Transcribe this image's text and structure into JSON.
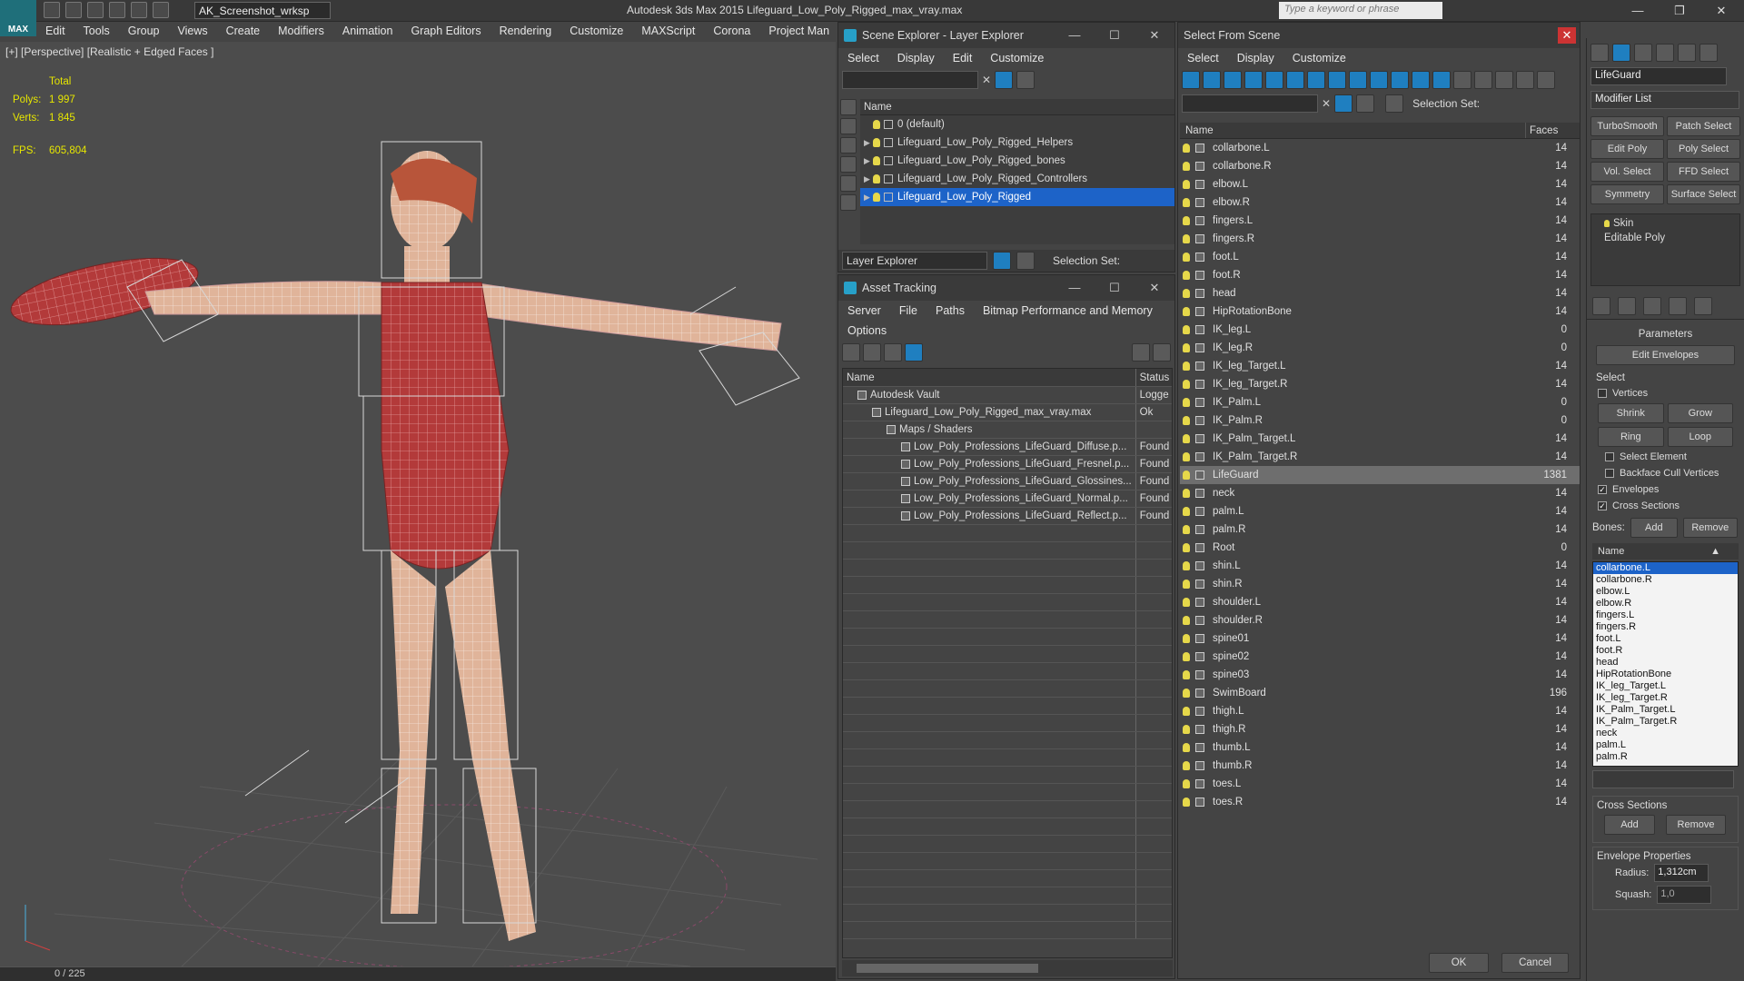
{
  "app": {
    "title": "Autodesk 3ds Max  2015     Lifeguard_Low_Poly_Rigged_max_vray.max",
    "logo": "MAX",
    "workspace": "AK_Screenshot_wrksp",
    "search_placeholder": "Type a keyword or phrase",
    "menu": [
      "Edit",
      "Tools",
      "Group",
      "Views",
      "Create",
      "Modifiers",
      "Animation",
      "Graph Editors",
      "Rendering",
      "Customize",
      "MAXScript",
      "Corona",
      "Project Man"
    ],
    "window_buttons": [
      "—",
      "❐",
      "✕"
    ]
  },
  "viewport": {
    "label": "[+] [Perspective] [Realistic + Edged Faces ]",
    "stats": {
      "total_label": "Total",
      "polys_label": "Polys:",
      "polys": "1 997",
      "verts_label": "Verts:",
      "verts": "1 845",
      "fps_label": "FPS:",
      "fps": "605,804"
    },
    "timeline": "0 / 225"
  },
  "scene_explorer": {
    "title": "Scene Explorer - Layer Explorer",
    "menu": [
      "Select",
      "Display",
      "Edit",
      "Customize"
    ],
    "column": "Name",
    "layers": [
      {
        "name": "0 (default)",
        "expandable": false,
        "selected": false
      },
      {
        "name": "Lifeguard_Low_Poly_Rigged_Helpers",
        "expandable": true,
        "selected": false
      },
      {
        "name": "Lifeguard_Low_Poly_Rigged_bones",
        "expandable": true,
        "selected": false
      },
      {
        "name": "Lifeguard_Low_Poly_Rigged_Controllers",
        "expandable": true,
        "selected": false
      },
      {
        "name": "Lifeguard_Low_Poly_Rigged",
        "expandable": true,
        "selected": true
      }
    ],
    "footer_label": "Layer Explorer",
    "selection_set": "Selection Set:"
  },
  "asset_tracking": {
    "title": "Asset Tracking",
    "menu": [
      "Server",
      "File",
      "Paths",
      "Bitmap Performance and Memory"
    ],
    "menu2": [
      "Options"
    ],
    "col_name": "Name",
    "col_status": "Status",
    "rows": [
      {
        "name": "Autodesk Vault",
        "status": "Logge",
        "indent": 1
      },
      {
        "name": "Lifeguard_Low_Poly_Rigged_max_vray.max",
        "status": "Ok",
        "indent": 2
      },
      {
        "name": "Maps / Shaders",
        "status": "",
        "indent": 3
      },
      {
        "name": "Low_Poly_Professions_LifeGuard_Diffuse.p...",
        "status": "Found",
        "indent": 4
      },
      {
        "name": "Low_Poly_Professions_LifeGuard_Fresnel.p...",
        "status": "Found",
        "indent": 4
      },
      {
        "name": "Low_Poly_Professions_LifeGuard_Glossines...",
        "status": "Found",
        "indent": 4
      },
      {
        "name": "Low_Poly_Professions_LifeGuard_Normal.p...",
        "status": "Found",
        "indent": 4
      },
      {
        "name": "Low_Poly_Professions_LifeGuard_Reflect.p...",
        "status": "Found",
        "indent": 4
      }
    ]
  },
  "select_from_scene": {
    "title": "Select From Scene",
    "menu": [
      "Select",
      "Display",
      "Customize"
    ],
    "selection_set": "Selection Set:",
    "col_name": "Name",
    "col_faces": "Faces",
    "rows": [
      {
        "name": "collarbone.L",
        "faces": "14"
      },
      {
        "name": "collarbone.R",
        "faces": "14"
      },
      {
        "name": "elbow.L",
        "faces": "14"
      },
      {
        "name": "elbow.R",
        "faces": "14"
      },
      {
        "name": "fingers.L",
        "faces": "14"
      },
      {
        "name": "fingers.R",
        "faces": "14"
      },
      {
        "name": "foot.L",
        "faces": "14"
      },
      {
        "name": "foot.R",
        "faces": "14"
      },
      {
        "name": "head",
        "faces": "14"
      },
      {
        "name": "HipRotationBone",
        "faces": "14"
      },
      {
        "name": "IK_leg.L",
        "faces": "0"
      },
      {
        "name": "IK_leg.R",
        "faces": "0"
      },
      {
        "name": "IK_leg_Target.L",
        "faces": "14"
      },
      {
        "name": "IK_leg_Target.R",
        "faces": "14"
      },
      {
        "name": "IK_Palm.L",
        "faces": "0"
      },
      {
        "name": "IK_Palm.R",
        "faces": "0"
      },
      {
        "name": "IK_Palm_Target.L",
        "faces": "14"
      },
      {
        "name": "IK_Palm_Target.R",
        "faces": "14"
      },
      {
        "name": "LifeGuard",
        "faces": "1381",
        "highlight": true
      },
      {
        "name": "neck",
        "faces": "14"
      },
      {
        "name": "palm.L",
        "faces": "14"
      },
      {
        "name": "palm.R",
        "faces": "14"
      },
      {
        "name": "Root",
        "faces": "0"
      },
      {
        "name": "shin.L",
        "faces": "14"
      },
      {
        "name": "shin.R",
        "faces": "14"
      },
      {
        "name": "shoulder.L",
        "faces": "14"
      },
      {
        "name": "shoulder.R",
        "faces": "14"
      },
      {
        "name": "spine01",
        "faces": "14"
      },
      {
        "name": "spine02",
        "faces": "14"
      },
      {
        "name": "spine03",
        "faces": "14"
      },
      {
        "name": "SwimBoard",
        "faces": "196"
      },
      {
        "name": "thigh.L",
        "faces": "14"
      },
      {
        "name": "thigh.R",
        "faces": "14"
      },
      {
        "name": "thumb.L",
        "faces": "14"
      },
      {
        "name": "thumb.R",
        "faces": "14"
      },
      {
        "name": "toes.L",
        "faces": "14"
      },
      {
        "name": "toes.R",
        "faces": "14"
      }
    ],
    "ok": "OK",
    "cancel": "Cancel"
  },
  "command_panel": {
    "object_name": "LifeGuard",
    "modifier_list": "Modifier List",
    "buttons": [
      [
        "TurboSmooth",
        "Patch Select"
      ],
      [
        "Edit Poly",
        "Poly Select"
      ],
      [
        "Vol. Select",
        "FFD Select"
      ],
      [
        "Symmetry",
        "Surface Select"
      ]
    ],
    "stack": [
      "Skin",
      "Editable Poly"
    ],
    "parameters": "Parameters",
    "edit_envelopes": "Edit Envelopes",
    "select_label": "Select",
    "vertices": "Vertices",
    "shrink": "Shrink",
    "grow": "Grow",
    "ring": "Ring",
    "loop": "Loop",
    "select_element": "Select Element",
    "backface": "Backface Cull Vertices",
    "envelopes": "Envelopes",
    "cross_sections": "Cross Sections",
    "bones_label": "Bones:",
    "add": "Add",
    "remove": "Remove",
    "name_col": "Name",
    "bones": [
      "collarbone.L",
      "collarbone.R",
      "elbow.L",
      "elbow.R",
      "fingers.L",
      "fingers.R",
      "foot.L",
      "foot.R",
      "head",
      "HipRotationBone",
      "IK_leg_Target.L",
      "IK_leg_Target.R",
      "IK_Palm_Target.L",
      "IK_Palm_Target.R",
      "neck",
      "palm.L",
      "palm.R"
    ],
    "cross_sections_title": "Cross Sections",
    "envelope_props": "Envelope Properties",
    "radius_label": "Radius:",
    "radius": "1,312cm",
    "squash_label": "Squash:",
    "squash": "1,0"
  }
}
